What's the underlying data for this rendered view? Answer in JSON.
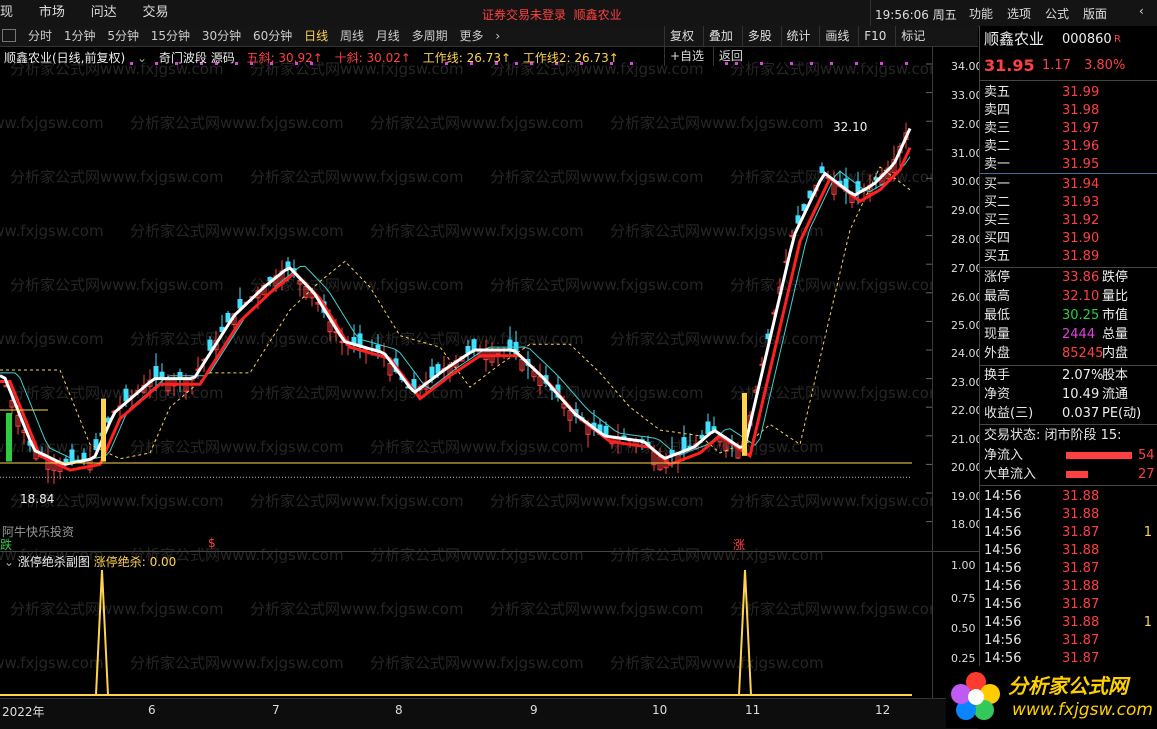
{
  "top_menu": [
    "现",
    "市场",
    "问达",
    "交易"
  ],
  "top_center": {
    "login": "证券交易未登录",
    "stock": "顺鑫农业"
  },
  "top_right": {
    "time": "19:56:06 周五",
    "menu": [
      "功能",
      "选项",
      "公式",
      "版面"
    ]
  },
  "periods": [
    "分时",
    "1分钟",
    "5分钟",
    "15分钟",
    "30分钟",
    "60分钟",
    "日线",
    "周线",
    "月线",
    "多周期",
    "更多"
  ],
  "active_period": "日线",
  "toolbar": [
    "复权",
    "叠加",
    "多股",
    "统计",
    "画线",
    "F10",
    "标记",
    "+自选",
    "返回"
  ],
  "main_legend": {
    "title": "顺鑫农业(日线,前复权)",
    "formula": "奇门波段 源码",
    "items": [
      {
        "label": "五斜: 30.92↑",
        "color": "#ff4040"
      },
      {
        "label": "十斜: 30.02↑",
        "color": "#ff4040"
      },
      {
        "label": "工作线: 26.73↑",
        "color": "#ffd34d"
      },
      {
        "label": "工作线2: 26.73↑",
        "color": "#ffd34d"
      }
    ]
  },
  "y_axis_main": [
    "34.00",
    "33.00",
    "32.00",
    "31.00",
    "30.00",
    "29.00",
    "28.00",
    "27.00",
    "26.00",
    "25.00",
    "24.00",
    "23.00",
    "22.00",
    "21.00",
    "20.00",
    "19.00",
    "18.00"
  ],
  "annotations": {
    "high": "32.10",
    "low": "18.84",
    "watermark": "阿牛快乐投资",
    "die": "跌",
    "dollar": "$",
    "zhang": "涨"
  },
  "sub_legend": {
    "title": "涨停绝杀副图",
    "item": "涨停绝杀: 0.00"
  },
  "y_axis_sub": [
    "1.00",
    "0.75",
    "0.50",
    "0.25"
  ],
  "x_axis": [
    "2022年",
    "6",
    "7",
    "8",
    "9",
    "10",
    "11",
    "12"
  ],
  "watermark_text": "分析家公式网www.fxjgsw.com",
  "quote": {
    "name": "顺鑫农业",
    "code": "000860",
    "tag": "R",
    "price": "31.95",
    "change": "1.17",
    "pct": "3.80%",
    "asks": [
      {
        "l": "卖五",
        "v": "31.99"
      },
      {
        "l": "卖四",
        "v": "31.98"
      },
      {
        "l": "卖三",
        "v": "31.97"
      },
      {
        "l": "卖二",
        "v": "31.96"
      },
      {
        "l": "卖一",
        "v": "31.95"
      }
    ],
    "bids": [
      {
        "l": "买一",
        "v": "31.94"
      },
      {
        "l": "买二",
        "v": "31.93"
      },
      {
        "l": "买三",
        "v": "31.92"
      },
      {
        "l": "买四",
        "v": "31.90"
      },
      {
        "l": "买五",
        "v": "31.89"
      }
    ],
    "stats": [
      {
        "l": "涨停",
        "v": "33.86",
        "r": "跌停"
      },
      {
        "l": "最高",
        "v": "32.10",
        "r": "量比"
      },
      {
        "l": "最低",
        "v": "30.25",
        "r": "市值"
      },
      {
        "l": "现量",
        "v": "2444",
        "r": "总量"
      },
      {
        "l": "外盘",
        "v": "85245",
        "r": "内盘"
      }
    ],
    "stats2": [
      {
        "l": "换手",
        "v": "2.07%",
        "r": "股本"
      },
      {
        "l": "净资",
        "v": "10.49",
        "r": "流通"
      },
      {
        "l": "收益(三)",
        "v": "0.037",
        "r": "PE(动)"
      }
    ],
    "trade_state": "交易状态: 闭市阶段 15:",
    "flows": [
      {
        "l": "净流入",
        "v": "54"
      },
      {
        "l": "大单流入",
        "v": "27"
      }
    ],
    "ticks": [
      {
        "t": "14:56",
        "p": "31.88",
        "v": ""
      },
      {
        "t": "14:56",
        "p": "31.88",
        "v": ""
      },
      {
        "t": "14:56",
        "p": "31.87",
        "v": "1"
      },
      {
        "t": "14:56",
        "p": "31.88",
        "v": ""
      },
      {
        "t": "14:56",
        "p": "31.87",
        "v": ""
      },
      {
        "t": "14:56",
        "p": "31.88",
        "v": ""
      },
      {
        "t": "14:56",
        "p": "31.87",
        "v": ""
      },
      {
        "t": "14:56",
        "p": "31.88",
        "v": "1"
      },
      {
        "t": "14:56",
        "p": "31.87",
        "v": ""
      },
      {
        "t": "14:56",
        "p": "31.87",
        "v": ""
      }
    ]
  },
  "logo": {
    "text": "分析家公式网",
    "url": "www.fxjgsw.com"
  },
  "colors": {
    "up": "#ff4040",
    "down": "#40e0ff",
    "ma_white": "#ffffff",
    "ma_red": "#ff2020",
    "work": "#ffd34d"
  }
}
